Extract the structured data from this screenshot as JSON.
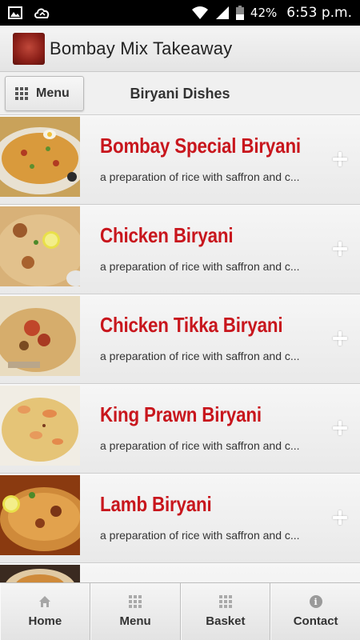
{
  "status_bar": {
    "battery": "42%",
    "time": "6:53 p.m."
  },
  "app": {
    "title": "Bombay Mix Takeaway",
    "logo_text": "BOMBAY MIX"
  },
  "header": {
    "menu_label": "Menu",
    "page_title": "Biryani Dishes"
  },
  "items": [
    {
      "name": "Bombay Special Biryani",
      "description": "a preparation of rice with saffron and c..."
    },
    {
      "name": "Chicken Biryani",
      "description": "a preparation of rice with saffron and c..."
    },
    {
      "name": "Chicken Tikka Biryani",
      "description": "a preparation of rice with saffron and c..."
    },
    {
      "name": "King Prawn Biryani",
      "description": "a preparation of rice with saffron and c..."
    },
    {
      "name": "Lamb Biryani",
      "description": "a preparation of rice with saffron and c..."
    },
    {
      "name": "",
      "description": ""
    }
  ],
  "bottom_nav": {
    "home": "Home",
    "menu": "Menu",
    "basket": "Basket",
    "contact": "Contact"
  },
  "colors": {
    "item_title": "#c8161d",
    "status_bar": "#000000"
  }
}
